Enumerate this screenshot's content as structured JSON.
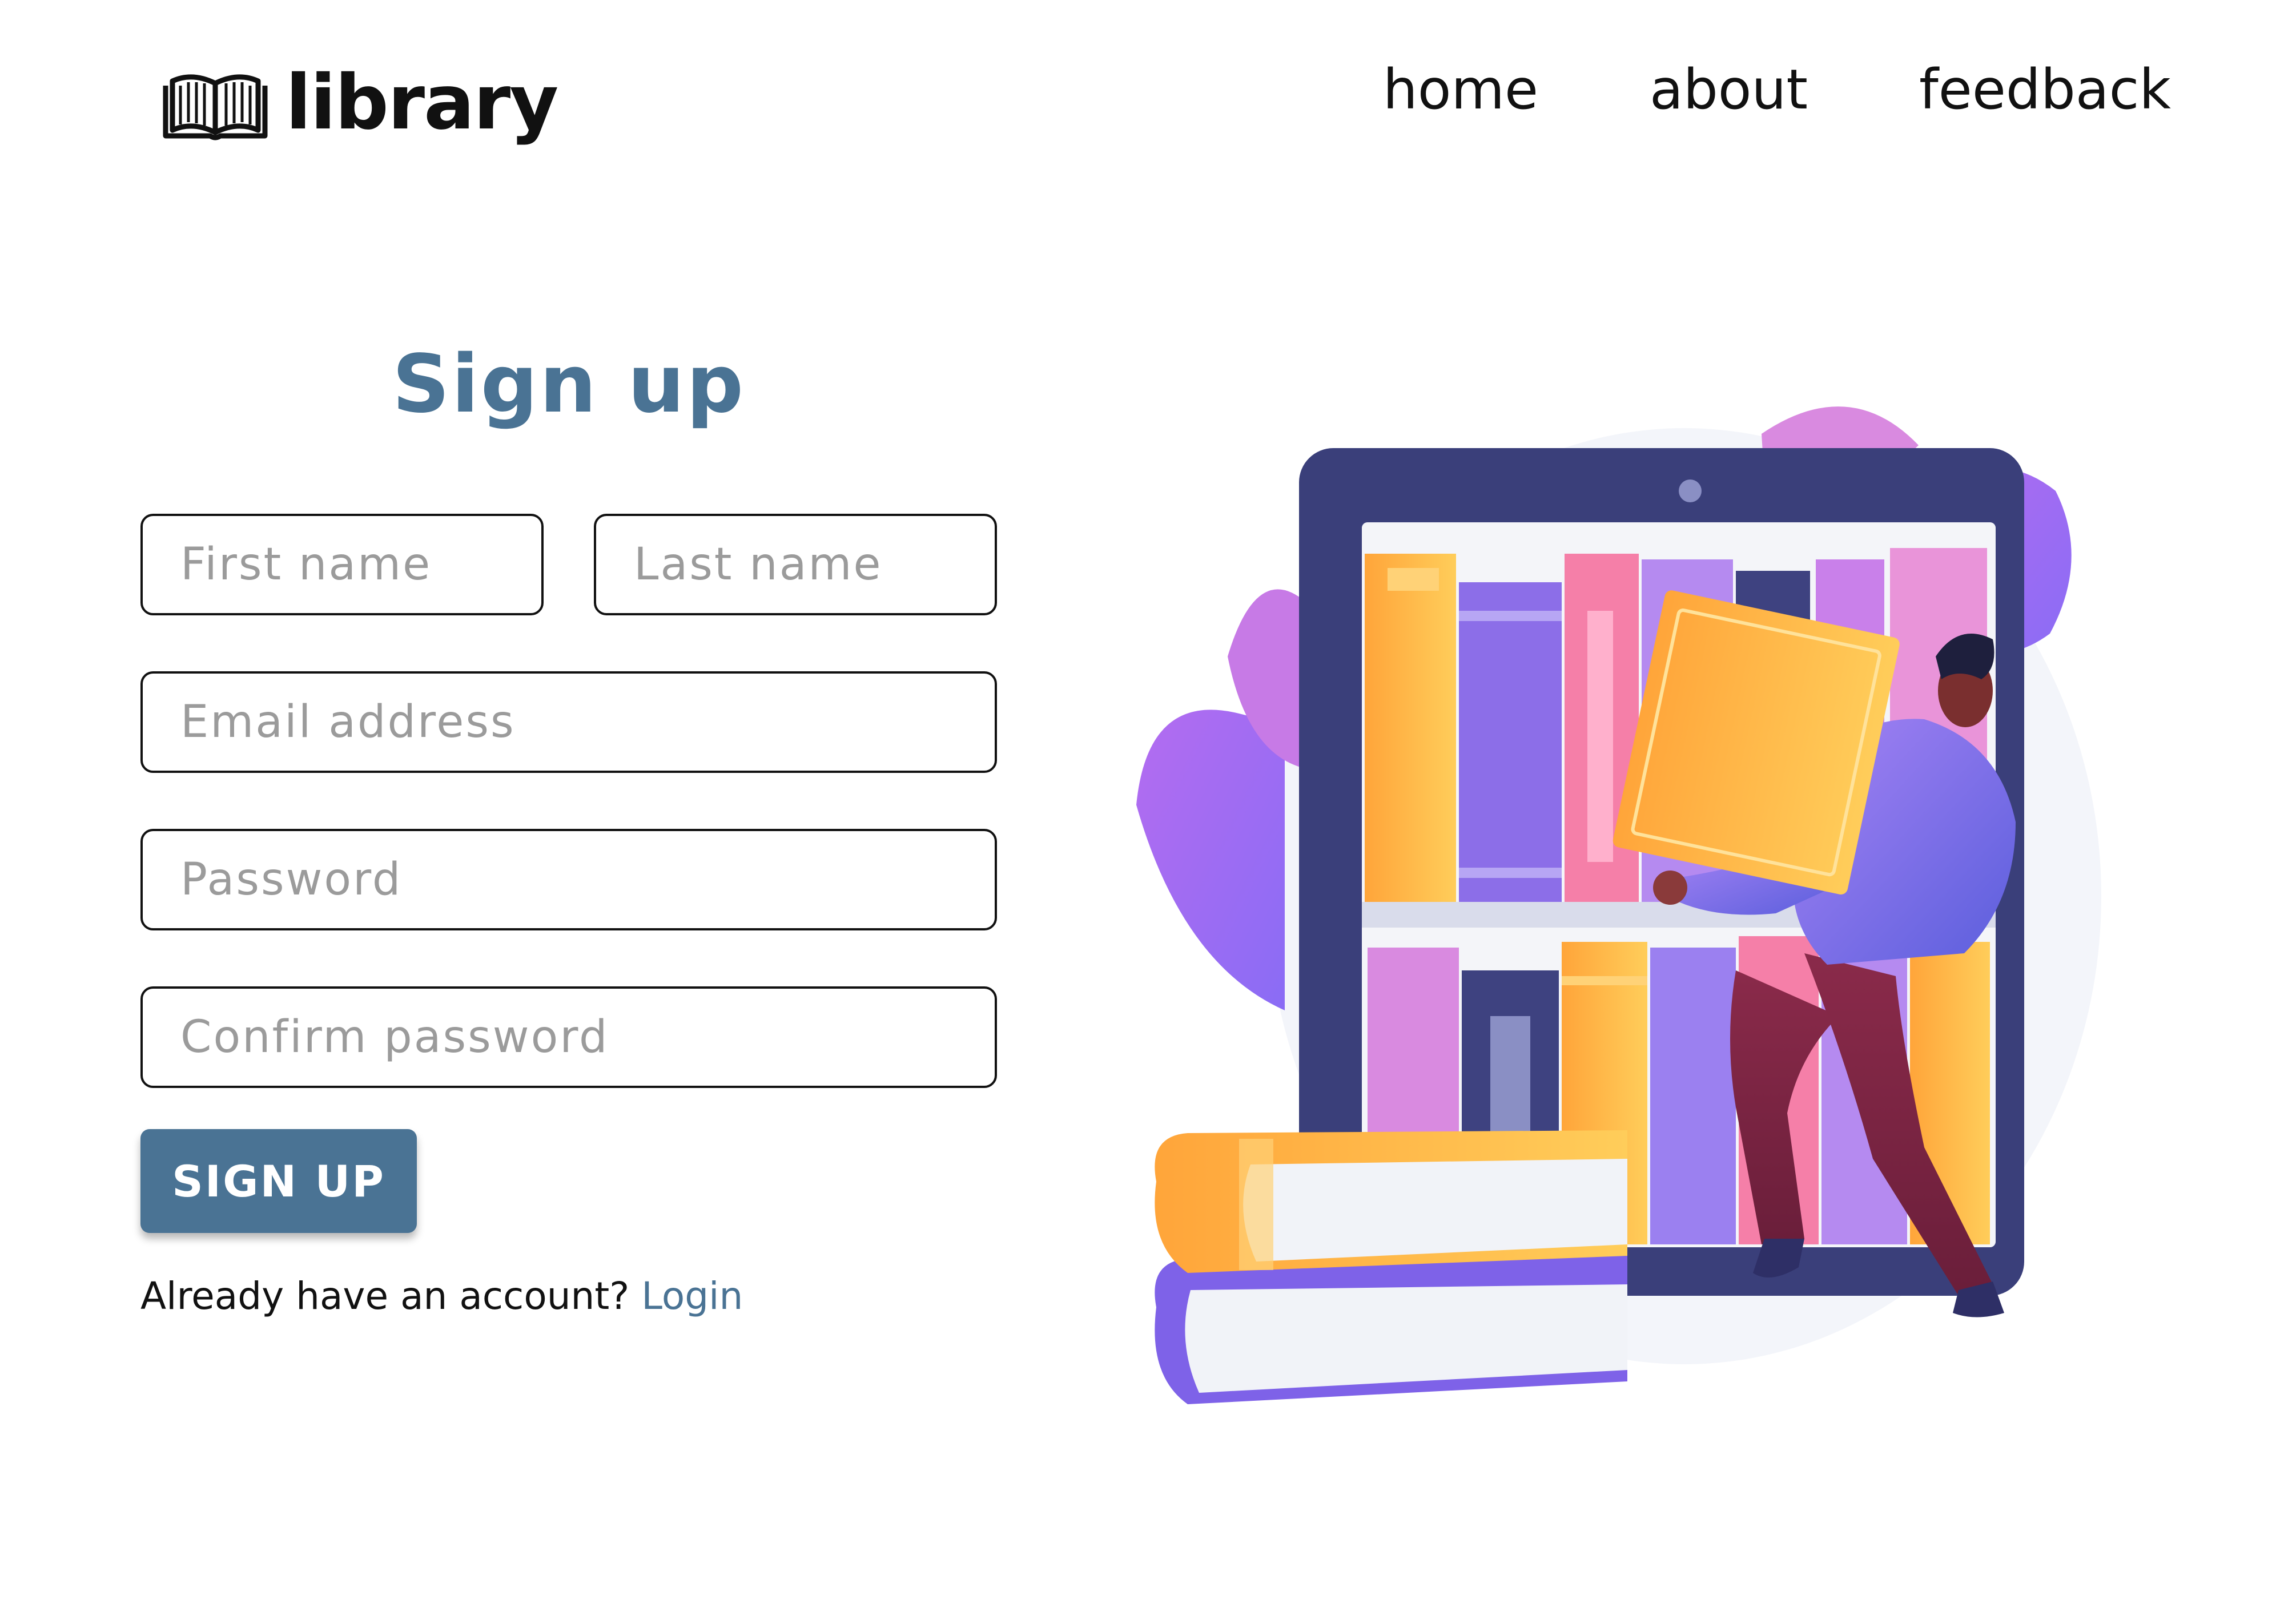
{
  "header": {
    "logo_text": "library",
    "logo_icon": "open-book-icon",
    "nav": [
      {
        "label": "home"
      },
      {
        "label": "about"
      },
      {
        "label": "feedback"
      }
    ]
  },
  "form": {
    "title": "Sign up",
    "first_name_placeholder": "First name",
    "last_name_placeholder": "Last name",
    "email_placeholder": "Email address",
    "password_placeholder": "Password",
    "confirm_placeholder": "Confirm password",
    "submit_label": "SIGN UP",
    "login_prompt": "Already have an account?",
    "login_link": "Login"
  },
  "illustration": {
    "subject": "person-placing-book-on-tablet-bookshelf"
  },
  "colors": {
    "accent": "#4a7394",
    "text": "#111111",
    "placeholder": "#9b9b9b",
    "tablet": "#3a3f7a",
    "purple": "#9b6ef0",
    "orange": "#ffb347",
    "pink": "#e07cd8"
  }
}
